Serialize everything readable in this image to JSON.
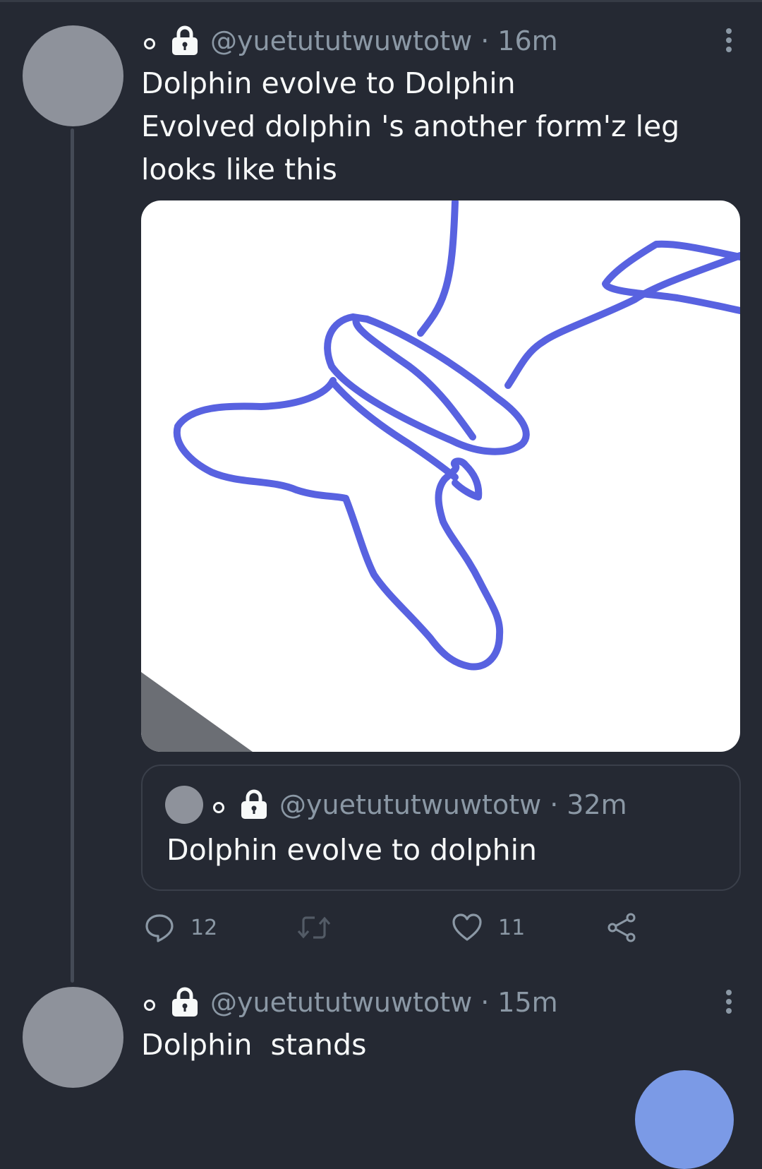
{
  "tweets": [
    {
      "handle": "@yuetututwuwtotw",
      "separator": "·",
      "time": "16m",
      "text_lines": [
        "Dolphin evolve to Dolphin",
        "Evolved dolphin 's another form'z leg",
        "looks like this"
      ],
      "quote": {
        "handle": "@yuetututwuwtotw",
        "separator": "·",
        "time": "32m",
        "text": "Dolphin evolve to dolphin"
      },
      "actions": {
        "reply_count": "12",
        "retweet_count": "",
        "like_count": "11"
      }
    },
    {
      "handle": "@yuetututwuwtotw",
      "separator": "·",
      "time": "15m",
      "text": "Dolphin  stands"
    }
  ],
  "icons": {
    "verified_lock": "lock-icon",
    "more": "more-vertical-icon",
    "reply": "reply-icon",
    "retweet": "retweet-icon",
    "like": "like-icon",
    "share": "share-icon"
  },
  "colors": {
    "background": "#252933",
    "secondary_text": "#8b98a5",
    "primary_text": "#f7f9f9",
    "drawing_stroke": "#5862e0",
    "avatar": "#8e929b",
    "fab": "#7b9ae6"
  }
}
